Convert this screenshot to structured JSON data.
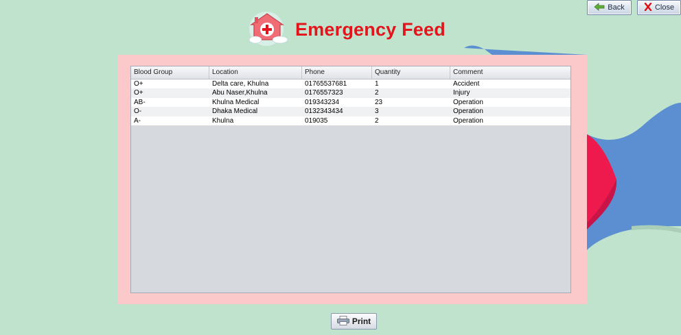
{
  "window": {
    "title": "Emergency Feed",
    "back_label": "Back",
    "close_label": "Close"
  },
  "table": {
    "columns": [
      "Blood Group",
      "Location",
      "Phone",
      "Quantity",
      "Comment"
    ],
    "rows": [
      [
        "O+",
        "Delta care, Khulna",
        "01765537681",
        "1",
        "Accident"
      ],
      [
        "O+",
        "Abu Naser,Khulna",
        "0176557323",
        "2",
        "Injury"
      ],
      [
        "AB-",
        "Khulna Medical",
        "019343234",
        "23",
        "Operation"
      ],
      [
        "O-",
        "Dhaka Medical",
        "0132343434",
        "3",
        "Operation"
      ],
      [
        "A-",
        "Khulna",
        "019035",
        "2",
        "Operation"
      ]
    ]
  },
  "footer": {
    "print_label": "Print"
  },
  "colors": {
    "background": "#bfe3cc",
    "panel": "#fbc9c9",
    "title": "#e3141c",
    "accent_blue": "#5b8fd1",
    "accent_red": "#ee1a4e"
  },
  "icons": {
    "back": "back-arrow-icon",
    "close": "red-x-icon",
    "logo": "hospital-house-icon",
    "print": "printer-icon"
  }
}
